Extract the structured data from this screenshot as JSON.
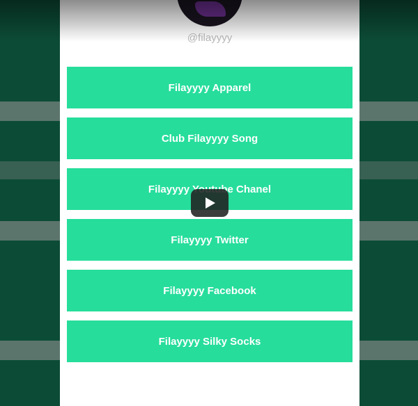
{
  "profile": {
    "handle": "@filayyyy"
  },
  "links": [
    {
      "label": "Filayyyy Apparel"
    },
    {
      "label": "Club Filayyyy Song"
    },
    {
      "label": "Filayyyy Youtube Chanel"
    },
    {
      "label": "Filayyyy Twitter"
    },
    {
      "label": "Filayyyy Facebook"
    },
    {
      "label": "Filayyyy Silky Socks"
    }
  ],
  "video": {
    "play_icon": "play-icon"
  },
  "colors": {
    "background": "#0c4c36",
    "button": "#26dd9c",
    "panel": "#ffffff",
    "handle_text": "#b9b9b9"
  }
}
